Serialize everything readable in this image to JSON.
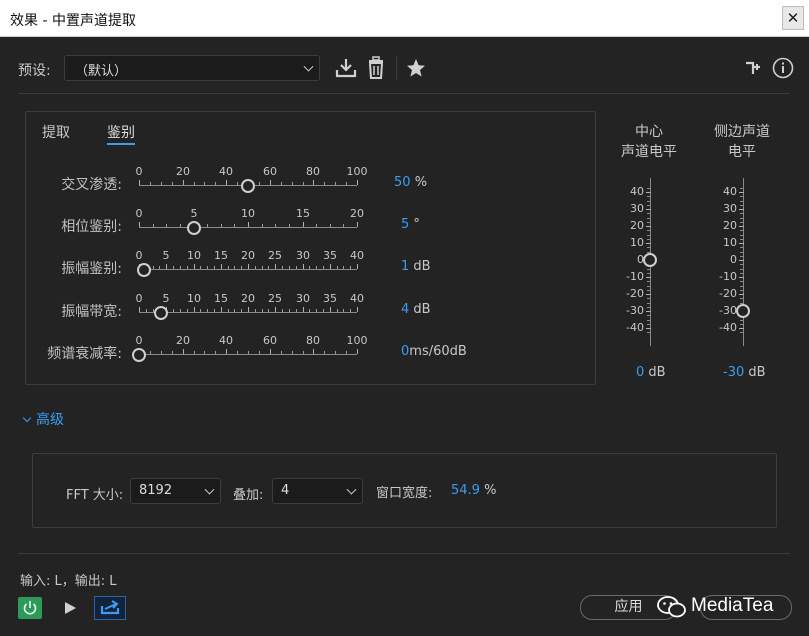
{
  "window": {
    "title": "效果 - 中置声道提取",
    "close_symbol": "✕"
  },
  "preset": {
    "label": "预设:",
    "value": "（默认）"
  },
  "tabs": [
    {
      "label": "提取",
      "active": false
    },
    {
      "label": "鉴别",
      "active": true
    }
  ],
  "sliders": [
    {
      "label": "交叉渗透:",
      "ticks": [
        "0",
        "20",
        "40",
        "60",
        "80",
        "100"
      ],
      "min": 0,
      "max": 100,
      "value": 50,
      "display": "50",
      "unit": "%"
    },
    {
      "label": "相位鉴别:",
      "ticks": [
        "0",
        "5",
        "10",
        "15",
        "20"
      ],
      "min": 0,
      "max": 20,
      "value": 5,
      "display": "5",
      "unit": "°"
    },
    {
      "label": "振幅鉴别:",
      "ticks": [
        "0",
        "5",
        "10",
        "15",
        "20",
        "25",
        "30",
        "35",
        "40"
      ],
      "min": 0,
      "max": 40,
      "value": 1,
      "display": "1",
      "unit": "dB"
    },
    {
      "label": "振幅带宽:",
      "ticks": [
        "0",
        "5",
        "10",
        "15",
        "20",
        "25",
        "30",
        "35",
        "40"
      ],
      "min": 0,
      "max": 40,
      "value": 4,
      "display": "4",
      "unit": "dB"
    },
    {
      "label": "频谱衰减率:",
      "ticks": [
        "0",
        "20",
        "40",
        "60",
        "80",
        "100"
      ],
      "min": 0,
      "max": 100,
      "value": 0,
      "display": "0",
      "unit": "ms/60dB"
    }
  ],
  "levels": [
    {
      "label_line1": "中心",
      "label_line2": "声道电平",
      "ticks": [
        "40",
        "30",
        "20",
        "10",
        "0",
        "-10",
        "-20",
        "-30",
        "-40"
      ],
      "value": 0,
      "display": "0",
      "unit": "dB"
    },
    {
      "label_line1": "侧边声道",
      "label_line2": "电平",
      "ticks": [
        "40",
        "30",
        "20",
        "10",
        "0",
        "-10",
        "-20",
        "-30",
        "-40"
      ],
      "value": -30,
      "display": "-30",
      "unit": "dB"
    }
  ],
  "advanced": {
    "toggle_label": "高级",
    "fft_label": "FFT 大小:",
    "fft_value": "8192",
    "overlap_label": "叠加:",
    "overlap_value": "4",
    "window_width_label": "窗口宽度:",
    "window_width_value": "54.9",
    "window_width_unit": "%"
  },
  "io_text": "输入: L，输出: L",
  "apply_label": "应用",
  "watermark": "MediaTea",
  "colors": {
    "accent": "#3b9cf0",
    "power_on": "#2e9a5a",
    "background": "#232323"
  }
}
